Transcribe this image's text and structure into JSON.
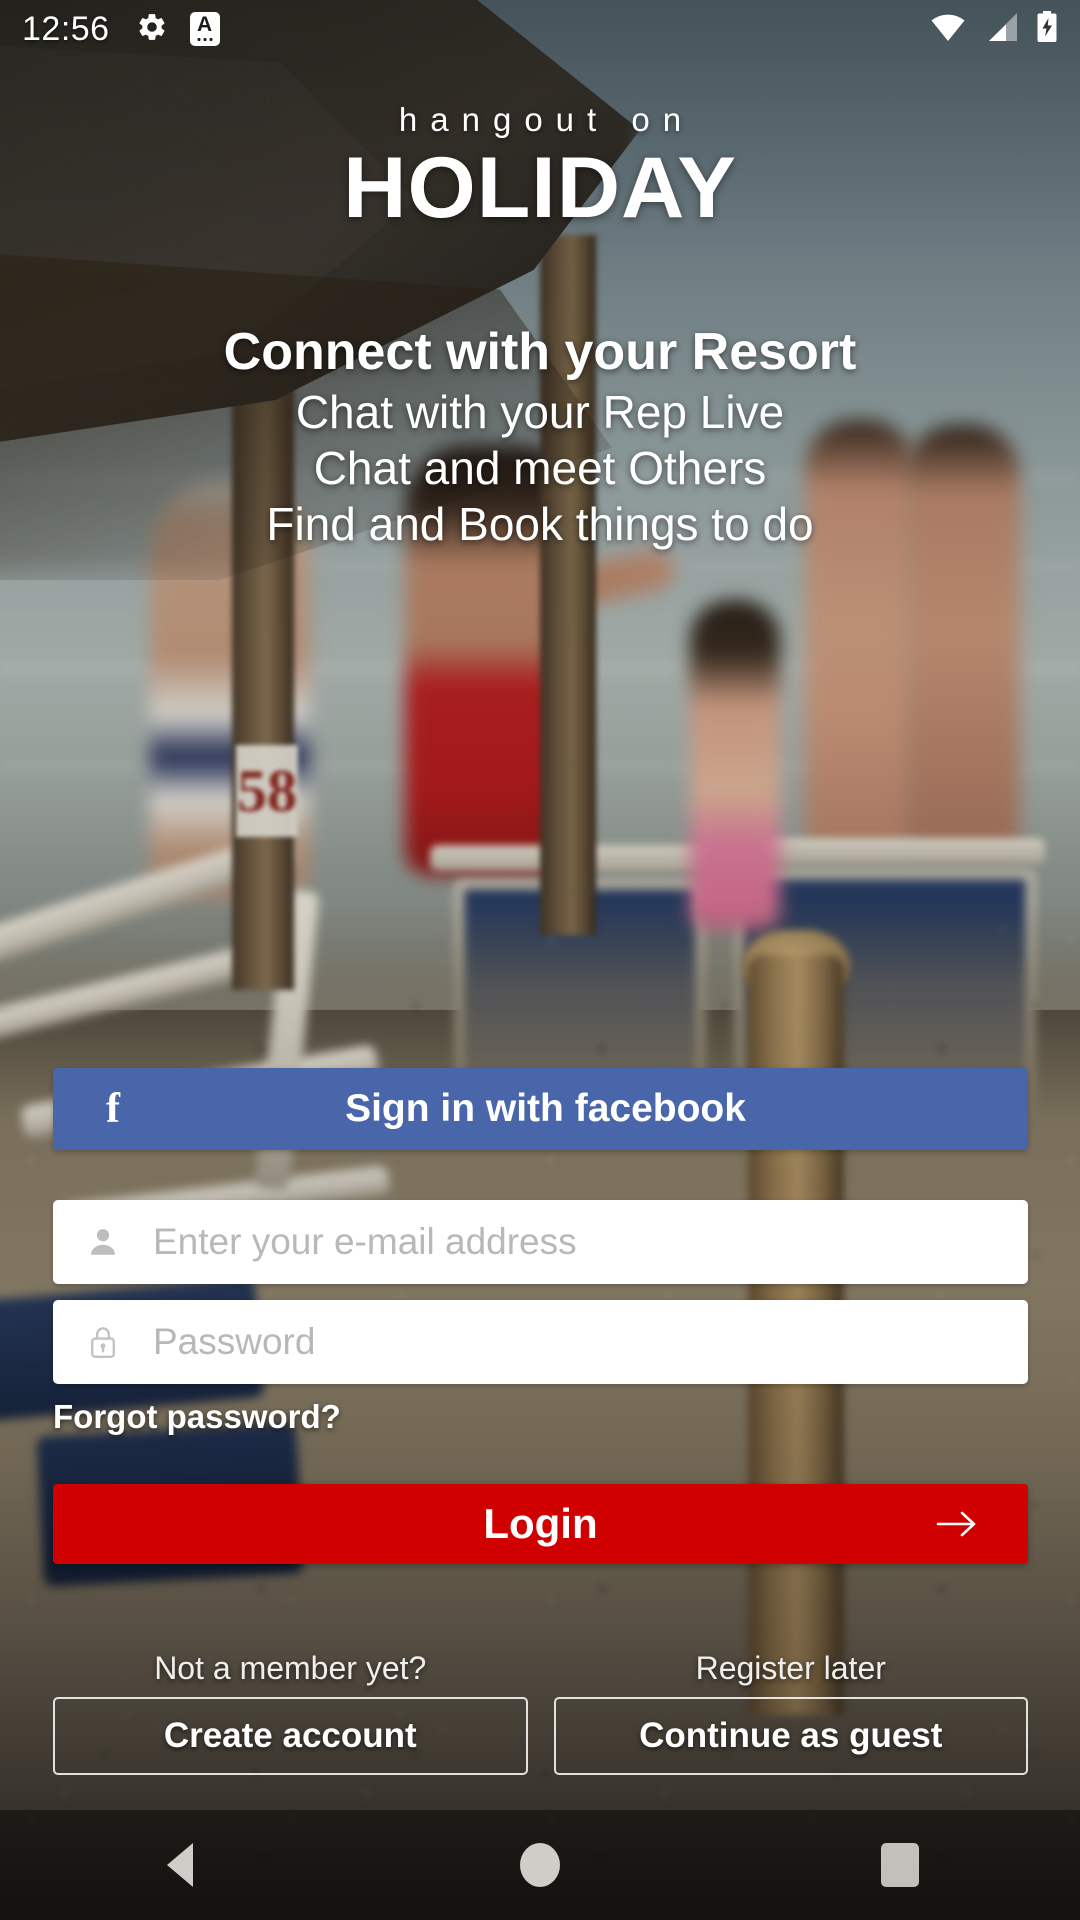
{
  "status_bar": {
    "time": "12:56",
    "left_icons": [
      "gear-icon",
      "keyboard-language-icon"
    ],
    "right_icons": [
      "wifi-icon",
      "cellular-signal-icon",
      "battery-charging-icon"
    ]
  },
  "branding": {
    "logo_top": "hangout on",
    "logo_main": "HOLIDAY"
  },
  "tagline": {
    "heading": "Connect with your Resort",
    "lines": [
      "Chat with your Rep Live",
      "Chat and meet Others",
      "Find and Book things to do"
    ]
  },
  "facebook": {
    "label": "Sign in with facebook",
    "glyph": "f",
    "color": "#4a66ab"
  },
  "form": {
    "email": {
      "placeholder": "Enter your e-mail address",
      "value": "",
      "icon": "person-icon"
    },
    "password": {
      "placeholder": "Password",
      "value": "",
      "icon": "lock-icon"
    },
    "forgot_label": "Forgot password?"
  },
  "login": {
    "label": "Login",
    "color": "#d10000",
    "arrow_icon": "arrow-right-icon"
  },
  "bottom": {
    "create": {
      "hint": "Not a member yet?",
      "label": "Create account"
    },
    "guest": {
      "hint": "Register later",
      "label": "Continue as guest"
    }
  },
  "nav_bar": {
    "back": "back-icon",
    "home": "home-icon",
    "recents": "recents-icon"
  },
  "background": {
    "marker_number": "58"
  }
}
